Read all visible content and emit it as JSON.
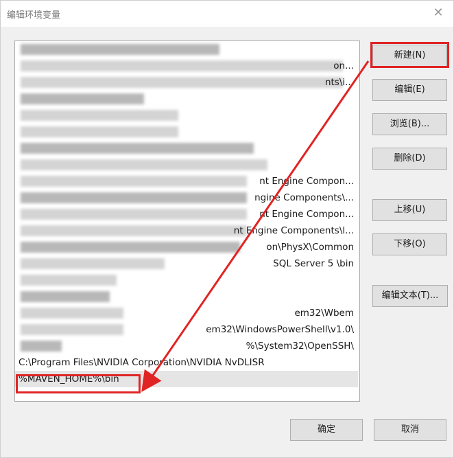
{
  "window": {
    "title": "编辑环境变量",
    "close_glyph": "✕"
  },
  "path_list": {
    "rows": [
      {
        "text": "",
        "visible_suffix": ""
      },
      {
        "text": "",
        "visible_suffix": "on..."
      },
      {
        "text": "",
        "visible_suffix": "nts\\i..."
      },
      {
        "text": "",
        "visible_suffix": ""
      },
      {
        "text": "",
        "visible_suffix": ""
      },
      {
        "text": "",
        "visible_suffix": ""
      },
      {
        "text": "",
        "visible_suffix": ""
      },
      {
        "text": "",
        "visible_suffix": ""
      },
      {
        "text": "",
        "visible_suffix": "nt Engine Compon..."
      },
      {
        "text": "",
        "visible_suffix": "ngine Components\\..."
      },
      {
        "text": "",
        "visible_suffix": "nt Engine Compon..."
      },
      {
        "text": "",
        "visible_suffix": "nt Engine Components\\l..."
      },
      {
        "text": "",
        "visible_suffix": "on\\PhysX\\Common"
      },
      {
        "text": "",
        "visible_suffix": "SQL Server 5 \\bin"
      },
      {
        "text": "",
        "visible_suffix": ""
      },
      {
        "text": "",
        "visible_suffix": ""
      },
      {
        "text": "",
        "visible_suffix": "em32\\Wbem"
      },
      {
        "text": "",
        "visible_suffix": "em32\\WindowsPowerShell\\v1.0\\"
      },
      {
        "text": "",
        "visible_suffix": "%\\System32\\OpenSSH\\"
      },
      {
        "text": "C:\\Program Files\\NVIDIA Corporation\\NVIDIA NvDLISR",
        "visible_suffix": ""
      },
      {
        "text": "%MAVEN_HOME%\\bin",
        "visible_suffix": ""
      }
    ],
    "selected_index": 20
  },
  "buttons": {
    "new": "新建(N)",
    "edit": "编辑(E)",
    "browse": "浏览(B)...",
    "delete": "删除(D)",
    "move_up": "上移(U)",
    "move_down": "下移(O)",
    "edit_text": "编辑文本(T)...",
    "ok": "确定",
    "cancel": "取消"
  },
  "annotation": {
    "color": "#e02424"
  }
}
